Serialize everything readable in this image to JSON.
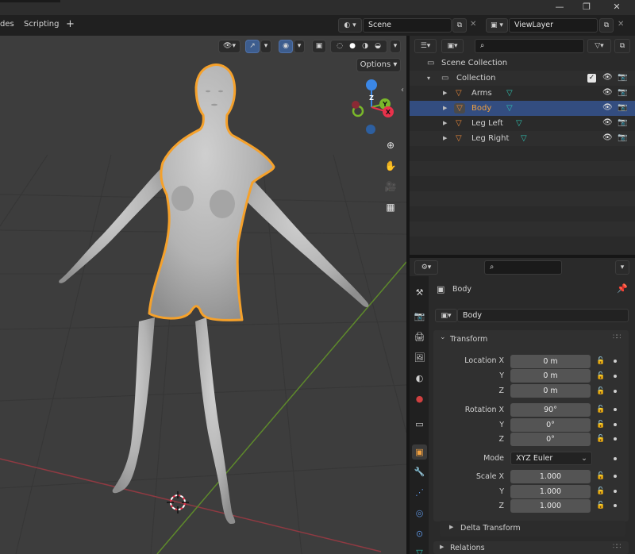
{
  "topbar": {
    "tab_partial": "des",
    "tab_scripting": "Scripting",
    "add_tab": "+",
    "scene": "Scene",
    "view_layer": "ViewLayer",
    "window_controls": [
      "—",
      "❐",
      "✕"
    ]
  },
  "viewport": {
    "options_label": "Options",
    "gizmo_axes": {
      "z": "Z",
      "y": "Y",
      "x": "X"
    }
  },
  "outliner": {
    "scene_collection": "Scene Collection",
    "collection": "Collection",
    "items": [
      {
        "label": "Arms",
        "selected": false
      },
      {
        "label": "Body",
        "selected": true
      },
      {
        "label": "Leg Left",
        "selected": false
      },
      {
        "label": "Leg Right",
        "selected": false
      }
    ]
  },
  "properties": {
    "object_name_header": "Body",
    "object_name_field": "Body",
    "transform_label": "Transform",
    "location_label": "Location X",
    "rotation_label": "Rotation X",
    "scale_label": "Scale X",
    "y_label": "Y",
    "z_label": "Z",
    "mode_label": "Mode",
    "location": [
      "0 m",
      "0 m",
      "0 m"
    ],
    "rotation": [
      "90°",
      "0°",
      "0°"
    ],
    "mode_value": "XYZ Euler",
    "scale": [
      "1.000",
      "1.000",
      "1.000"
    ],
    "delta_transform_label": "Delta Transform",
    "relations_label": "Relations"
  },
  "colors": {
    "selection_outline": "#f5a12b",
    "outliner_selected_row": "#334d80",
    "axis_x": "#e8324b",
    "axis_y": "#7ab82a",
    "axis_z": "#3b87e6"
  }
}
